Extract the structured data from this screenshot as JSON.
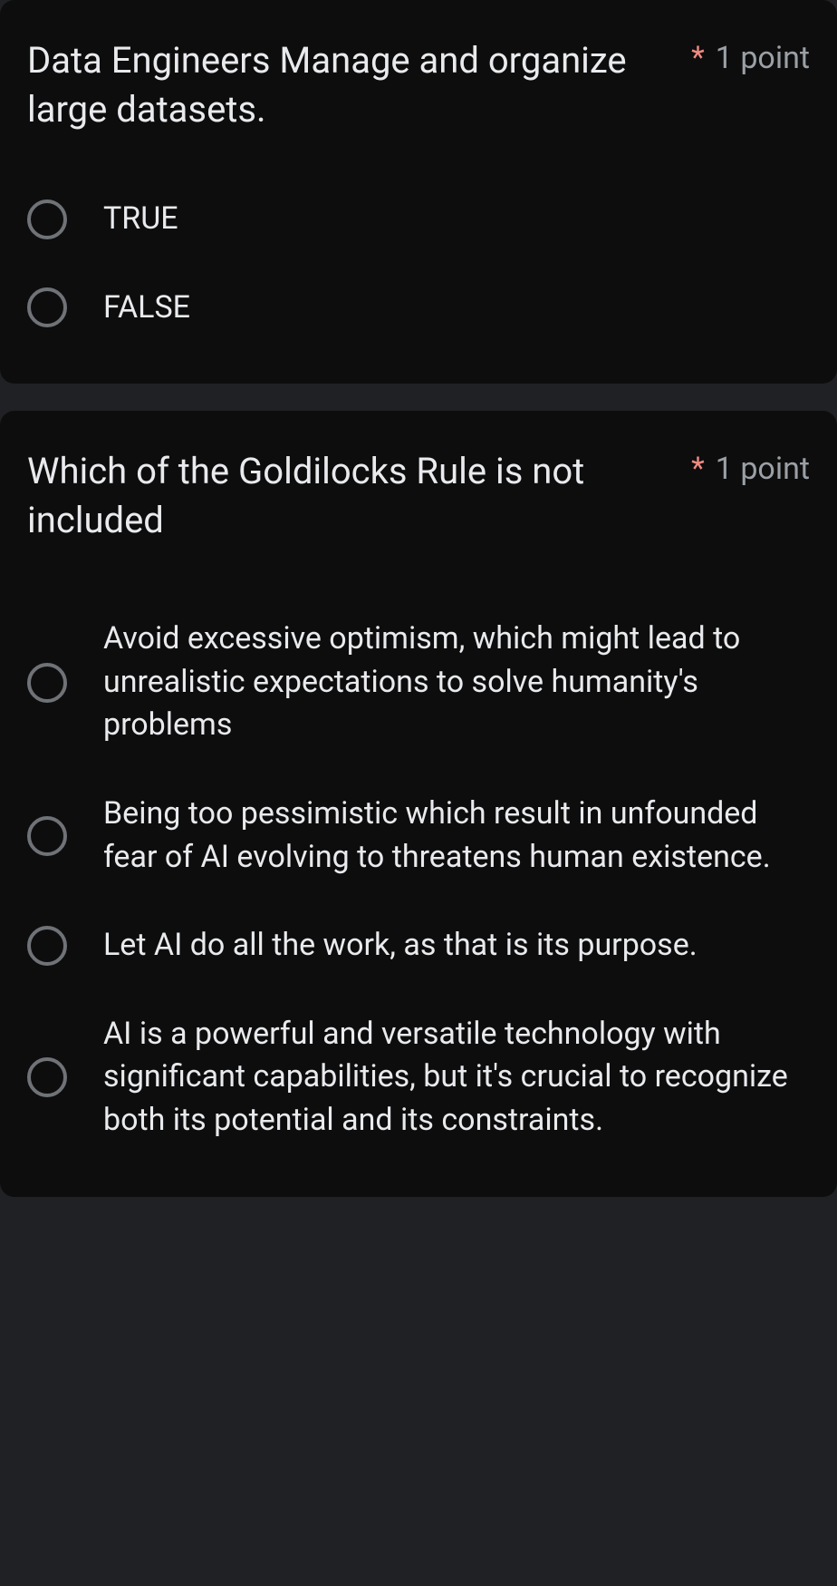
{
  "required_marker": "*",
  "questions": [
    {
      "text": "Data Engineers Manage and organize large datasets.",
      "points": "1 point",
      "options": [
        "TRUE",
        "FALSE"
      ]
    },
    {
      "text": "Which of the Goldilocks Rule is not included",
      "points": "1 point",
      "options": [
        "Avoid excessive optimism, which might lead to unrealistic expectations to solve humanity's problems",
        "Being too pessimistic which result in unfounded fear of AI evolving to threatens human existence.",
        "Let AI do all the work, as that is its purpose.",
        "AI is a powerful and versatile technology with significant capabilities, but it's crucial to recognize both its potential and its constraints."
      ]
    }
  ]
}
